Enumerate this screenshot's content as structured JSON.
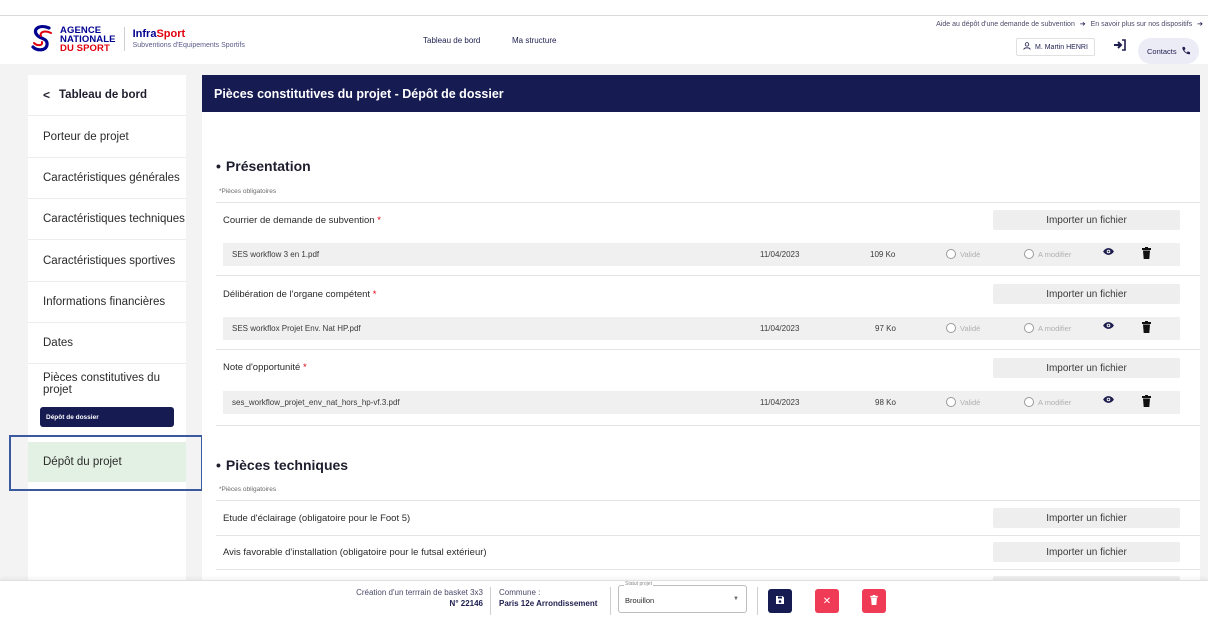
{
  "header": {
    "agency_lines": [
      "AGENCE",
      "NATIONALE",
      "DU SPORT"
    ],
    "brand_prefix": "Infra",
    "brand_suffix": "Sport",
    "brand_subtitle": "Subventions d'Equipements Sportifs",
    "nav": [
      "Tableau de bord",
      "Ma structure"
    ],
    "help_link_1": "Aide au dépôt d'une demande de subvention",
    "help_link_2": "En savoir plus sur nos dispositifs",
    "user_name": "M. Martin HENRI",
    "contacts_label": "Contacts"
  },
  "sidebar": {
    "back_label": "Tableau de bord",
    "items": [
      "Porteur de projet",
      "Caractéristiques générales",
      "Caractéristiques techniques",
      "Caractéristiques sportives",
      "Informations financières",
      "Dates",
      "Pièces constitutives du projet"
    ],
    "sub_item": "Dépôt de dossier",
    "active_item": "Dépôt du projet"
  },
  "main": {
    "title": "Pièces constitutives du projet - Dépôt de dossier",
    "import_label": "Importer un fichier",
    "validated_label": "Validé",
    "to_modify_label": "A modifier",
    "sections": [
      {
        "title": "Présentation",
        "required_note": "*Pièces obligatoires",
        "documents": [
          {
            "label": "Courrier de demande de subvention",
            "required": "*",
            "file": {
              "name": "SES workflow 3 en 1.pdf",
              "date": "11/04/2023",
              "size": "109 Ko"
            }
          },
          {
            "label": "Délibération de l'organe compétent",
            "required": "*",
            "file": {
              "name": "SES workflox Projet Env. Nat HP.pdf",
              "date": "11/04/2023",
              "size": "97 Ko"
            }
          },
          {
            "label": "Note d'opportunité",
            "required": "*",
            "file": {
              "name": "ses_workflow_projet_env_nat_hors_hp-vf.3.pdf",
              "date": "11/04/2023",
              "size": "98 Ko"
            }
          }
        ]
      },
      {
        "title": "Pièces techniques",
        "required_note": "*Pièces obligatoires",
        "documents": [
          {
            "label": "Etude d'éclairage (obligatoire pour le Foot 5)"
          },
          {
            "label": "Avis favorable d'installation (obligatoire pour le futsal extérieur)"
          }
        ]
      }
    ]
  },
  "bottom_bar": {
    "project_name": "Création d'un terrrain de basket 3x3",
    "project_number": "N° 22146",
    "commune_label": "Commune :",
    "commune_value": "Paris 12e Arrondissement",
    "status_legend": "Statut projet",
    "status_value": "Brouillon"
  },
  "colors": {
    "navy": "#161b52",
    "marianne_blue": "#000091",
    "marianne_red": "#e1000f",
    "danger": "#ef3b55",
    "active_green": "#e3f1e4"
  },
  "icons": [
    "back-chevron-icon",
    "user-icon",
    "logout-icon",
    "phone-icon",
    "eye-icon",
    "trash-icon",
    "save-icon",
    "close-icon",
    "arrow-right-icon",
    "caret-down-icon"
  ]
}
